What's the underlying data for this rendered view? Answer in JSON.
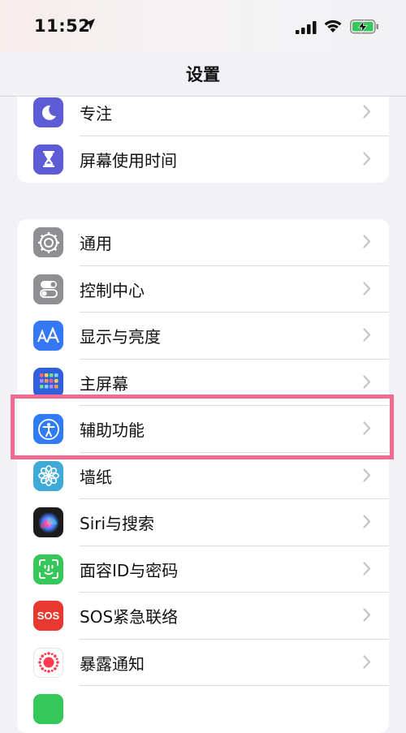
{
  "status_bar": {
    "time": "11:52"
  },
  "nav": {
    "title": "设置"
  },
  "group1": [
    {
      "label": "专注",
      "icon": "moon-icon",
      "color": "#5d5cd6"
    },
    {
      "label": "屏幕使用时间",
      "icon": "hourglass-icon",
      "color": "#5d5cd6"
    }
  ],
  "group2": [
    {
      "label": "通用",
      "icon": "gear-icon",
      "color": "#8e8e93"
    },
    {
      "label": "控制中心",
      "icon": "toggles-icon",
      "color": "#8e8e93"
    },
    {
      "label": "显示与亮度",
      "icon": "text-size-icon",
      "color": "#3478f6"
    },
    {
      "label": "主屏幕",
      "icon": "home-grid-icon",
      "color": "#2f5fdc"
    },
    {
      "label": "辅助功能",
      "icon": "accessibility-icon",
      "color": "#2f7cf6"
    },
    {
      "label": "墙纸",
      "icon": "flower-icon",
      "color": "#3fa9d8"
    },
    {
      "label": "Siri与搜索",
      "icon": "siri-icon",
      "color": "#1c1c1e"
    },
    {
      "label": "面容ID与密码",
      "icon": "face-id-icon",
      "color": "#35c759"
    },
    {
      "label": "SOS紧急联络",
      "icon": "sos-icon",
      "color": "#e8382f",
      "icon_text": "SOS"
    },
    {
      "label": "暴露通知",
      "icon": "exposure-icon",
      "color": "#ffffff"
    }
  ],
  "highlight_color": "#ef6b92"
}
